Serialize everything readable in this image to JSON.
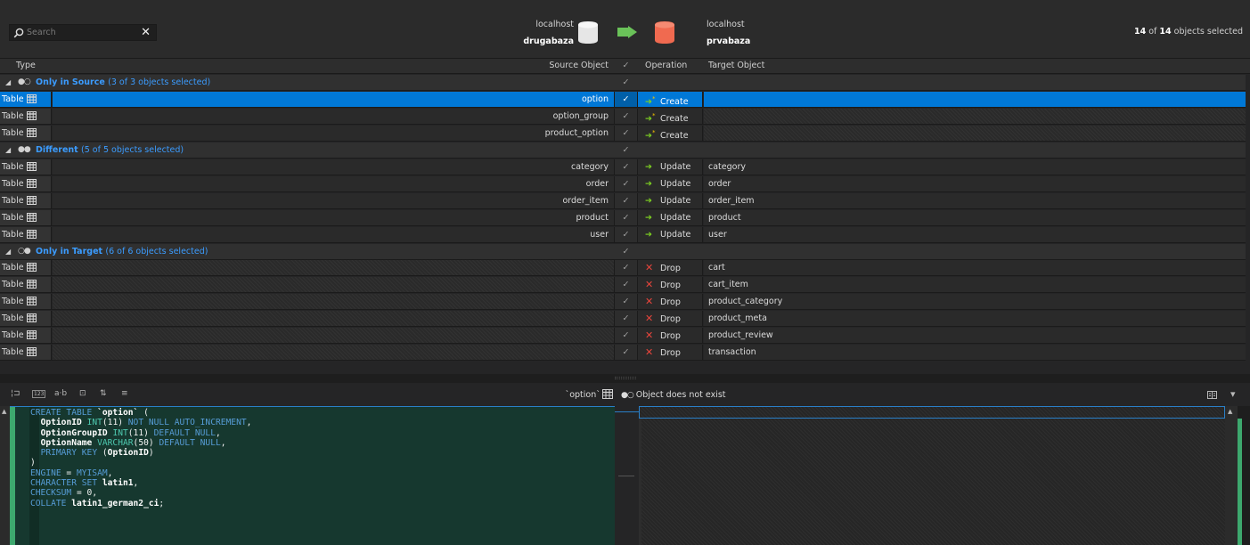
{
  "toolbar": {
    "search_placeholder": "Search",
    "clear_glyph": "✕",
    "source": {
      "host": "localhost",
      "database": "drugabaza"
    },
    "target": {
      "host": "localhost",
      "database": "prvabaza"
    },
    "selected_count": "14",
    "selected_of": " of ",
    "selected_total": "14",
    "selected_suffix": " objects selected"
  },
  "grid": {
    "columns": {
      "type": "Type",
      "source": "Source Object",
      "operation": "Operation",
      "target": "Target Object"
    },
    "check_glyph": "✓",
    "type_label": "Table",
    "groups": [
      {
        "dots": "●○",
        "name": "Only in Source",
        "count": "(3 of 3 objects selected)",
        "rows": [
          {
            "source": "option",
            "operation": "Create",
            "target": ""
          },
          {
            "source": "option_group",
            "operation": "Create",
            "target": ""
          },
          {
            "source": "product_option",
            "operation": "Create",
            "target": ""
          }
        ]
      },
      {
        "dots": "●●",
        "name": "Different",
        "count": "(5 of 5 objects selected)",
        "rows": [
          {
            "source": "category",
            "operation": "Update",
            "target": "category"
          },
          {
            "source": "order",
            "operation": "Update",
            "target": "order"
          },
          {
            "source": "order_item",
            "operation": "Update",
            "target": "order_item"
          },
          {
            "source": "product",
            "operation": "Update",
            "target": "product"
          },
          {
            "source": "user",
            "operation": "Update",
            "target": "user"
          }
        ]
      },
      {
        "dots": "○●",
        "name": "Only in Target",
        "count": "(6 of 6 objects selected)",
        "rows": [
          {
            "source": "",
            "operation": "Drop",
            "target": "cart"
          },
          {
            "source": "",
            "operation": "Drop",
            "target": "cart_item"
          },
          {
            "source": "",
            "operation": "Drop",
            "target": "product_category"
          },
          {
            "source": "",
            "operation": "Drop",
            "target": "product_meta"
          },
          {
            "source": "",
            "operation": "Drop",
            "target": "product_review"
          },
          {
            "source": "",
            "operation": "Drop",
            "target": "transaction"
          }
        ]
      }
    ]
  },
  "script_panel": {
    "buttons": [
      "¦⊐",
      "123",
      "a·b",
      "⊡",
      "⇅",
      "≡"
    ],
    "object_name": "`option`",
    "object_status_dots": "●○",
    "object_status": "Object does not exist",
    "menu_glyph": "▾"
  },
  "colors": {
    "selected_row": "#0078d7",
    "group_text": "#3b9cff",
    "create_arrow": "#7ed321",
    "drop": "#e8453c",
    "editor_bg": "#16382f"
  }
}
